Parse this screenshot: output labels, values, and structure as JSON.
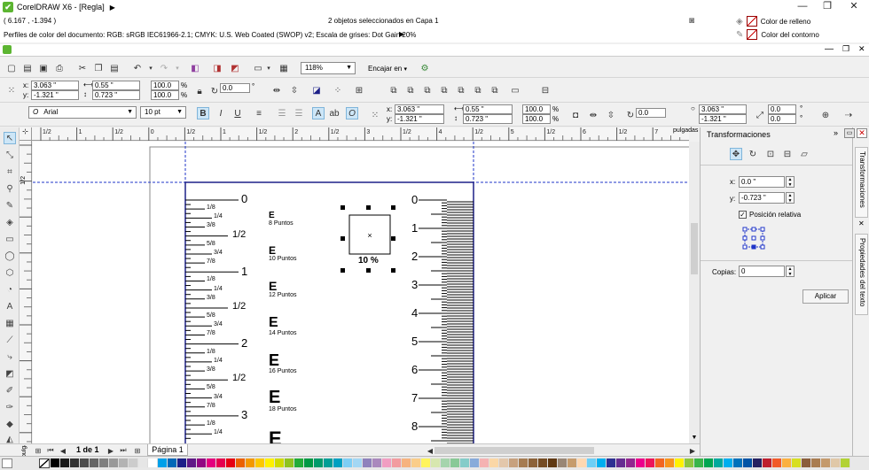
{
  "window": {
    "title": "CorelDRAW X6 - [Regla]",
    "status_center": "2 objetos seleccionados en Capa 1",
    "coords": "( 6.167 , -1.394 )",
    "profile": "Perfiles de color del documento: RGB: sRGB IEC61966-2.1; CMYK: U.S. Web Coated (SWOP) v2; Escala de grises: Dot Gain 20%",
    "fill_label": "Color de relleno",
    "outline_label": "Color del contorno"
  },
  "toolbar": {
    "zoom": "118%",
    "snap": "Encajar en"
  },
  "propbar": {
    "x_label": "x:",
    "y_label": "y:",
    "x": "3.063 \"",
    "y": "-1.321 \"",
    "w": "0.55 \"",
    "h": "0.723 \"",
    "scale_w": "100.0",
    "scale_h": "100.0",
    "percent": "%",
    "rotation": "0.0",
    "degree": "°"
  },
  "textbar": {
    "font": "Arial",
    "size": "10 pt",
    "x": "3.063 \"",
    "y": "-1.321 \"",
    "w": "0.55 \"",
    "h": "0.723 \"",
    "scale_w": "100.0",
    "scale_h": "100.0",
    "rotation": "0.0",
    "rx": "3.063 \"",
    "ry": "-1.321 \"",
    "r1": "0.0",
    "r2": "0.0"
  },
  "ruler": {
    "h_marks": [
      "1/2",
      "1",
      "1/2",
      "0",
      "1/2",
      "1",
      "1/2",
      "2",
      "1/2",
      "3",
      "1/2",
      "4",
      "1/2",
      "5",
      "1/2",
      "6",
      "1/2",
      "7",
      "1/2"
    ],
    "unit": "pulgadas",
    "v_mark": "1/2"
  },
  "drawing": {
    "inch_big": [
      "0",
      "1",
      "2",
      "3"
    ],
    "inch_half": [
      "1/2",
      "1/2",
      "1/2"
    ],
    "inch_small": [
      "1/8",
      "1/4",
      "3/8",
      "5/8",
      "3/4",
      "7/8"
    ],
    "cm_labels": [
      "0",
      "1",
      "2",
      "3",
      "4",
      "5",
      "6",
      "7",
      "8"
    ],
    "font_samples": [
      {
        "letter": "E",
        "label": "8 Puntos"
      },
      {
        "letter": "E",
        "label": "10 Puntos"
      },
      {
        "letter": "E",
        "label": "12 Puntos"
      },
      {
        "letter": "E",
        "label": "14 Puntos"
      },
      {
        "letter": "E",
        "label": "16 Puntos"
      },
      {
        "letter": "E",
        "label": "18 Puntos"
      },
      {
        "letter": "E",
        "label": ""
      }
    ],
    "selection_label": "10 %"
  },
  "pagebar": {
    "page_count": "1 de 1",
    "page_tab": "Página 1",
    "v_unit": "pulgadas"
  },
  "docker": {
    "title": "Transformaciones",
    "x_label": "x:",
    "y_label": "y:",
    "x": "0.0 \"",
    "y": "-0.723 \"",
    "relative": "Posición relativa",
    "copies_label": "Copias:",
    "copies": "0",
    "apply": "Aplicar",
    "tab1": "Transformaciones",
    "tab2": "Propiedades del texto"
  },
  "palette_colors": [
    "#000000",
    "#1a1a1a",
    "#333333",
    "#4d4d4d",
    "#666666",
    "#808080",
    "#999999",
    "#b3b3b3",
    "#cccccc",
    "#e6e6e6",
    "#ffffff",
    "#00a0e9",
    "#0068b7",
    "#1d2088",
    "#601986",
    "#920783",
    "#e4007f",
    "#e5004f",
    "#e60012",
    "#eb6100",
    "#f39800",
    "#fcc800",
    "#fff100",
    "#cfdb00",
    "#8fc31f",
    "#22ac38",
    "#009944",
    "#009b6b",
    "#009e96",
    "#00a0c1",
    "#7ecef4",
    "#a3d7f4",
    "#8f82bc",
    "#aa89bd",
    "#f19ec2",
    "#f29c9f",
    "#f6b37f",
    "#facd89",
    "#fff45c",
    "#d7e7af",
    "#a5d4ad",
    "#89c997",
    "#84ccc9",
    "#88abda",
    "#f5b2b2",
    "#fbd7a6",
    "#e3c7ab",
    "#c7a17e",
    "#a67c52",
    "#8c6239",
    "#754c24",
    "#603913",
    "#998675",
    "#c69c6d",
    "#ffd8b1",
    "#6dcff6",
    "#00aeef",
    "#2e3192",
    "#662d91",
    "#92278f",
    "#ec008c",
    "#ed145b",
    "#f26522",
    "#f7941d",
    "#fff200",
    "#8dc63f",
    "#39b54a",
    "#00a651",
    "#00a99d",
    "#00aeef",
    "#0072bc",
    "#0054a6",
    "#262262",
    "#be1e2d",
    "#f15a29",
    "#fbb040",
    "#d7df23",
    "#8b5e3c",
    "#a97c50",
    "#c49a6c",
    "#e0c8a8",
    "#b2d235"
  ]
}
